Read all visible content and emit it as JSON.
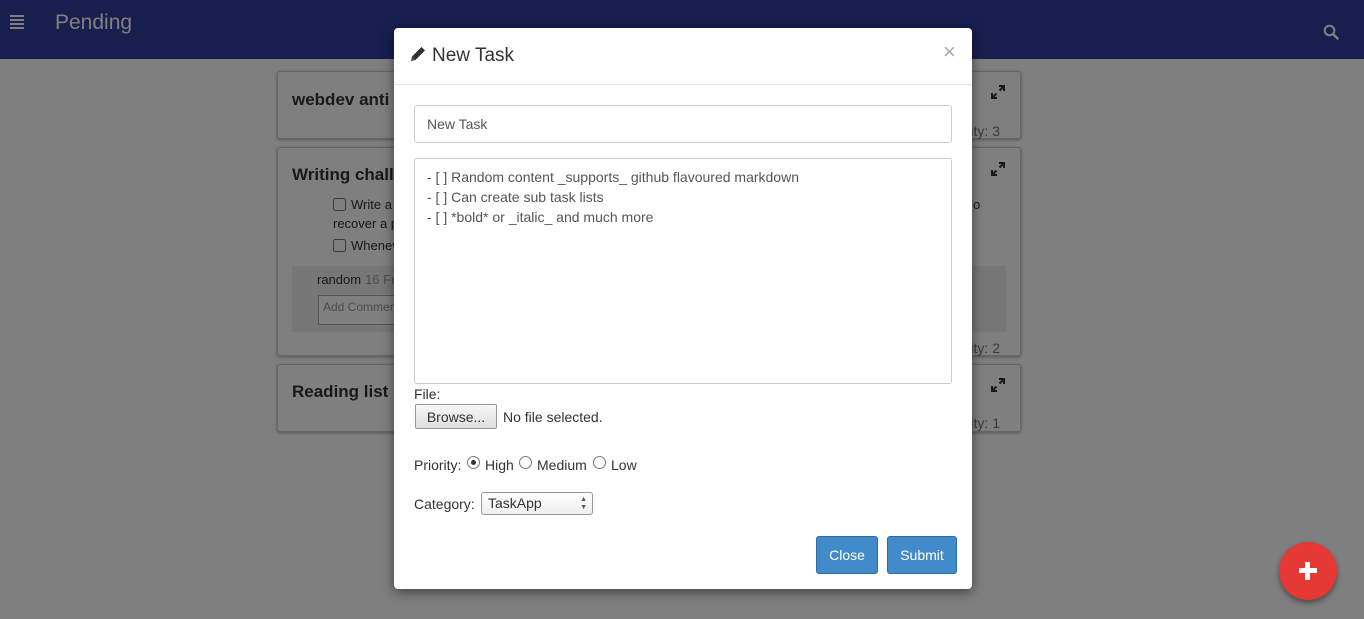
{
  "navbar": {
    "title": "Pending",
    "menu_icon": "hamburger-menu-icon",
    "search_icon": "search-icon",
    "color": "#303f9f"
  },
  "cards": [
    {
      "title": "webdev anti",
      "priority": "ity: 3"
    },
    {
      "title": "Writing chall",
      "priority": "ity: 2",
      "items": [
        {
          "line1": "Write a",
          "line1_tail": "o",
          "line2": "recover a p"
        },
        {
          "line1": "Whenev"
        }
      ],
      "comment": {
        "user": "random",
        "date": "16 Fe",
        "placeholder": "Add Commen"
      }
    },
    {
      "title": "Reading list",
      "priority": "ity: 1"
    }
  ],
  "modal": {
    "title": "New Task",
    "title_icon": "pencil-icon",
    "close_symbol": "×",
    "task_title_value": "New Task",
    "description_value": "- [ ] Random content _supports_ github flavoured markdown\n- [ ] Can create sub task lists\n- [ ] *bold* or _italic_ and much more",
    "file_label": "File:",
    "browse_label": "Browse...",
    "file_status": "No file selected.",
    "priority_label": "Priority:",
    "priority_options": [
      {
        "label": "High",
        "checked": true
      },
      {
        "label": "Medium",
        "checked": false
      },
      {
        "label": "Low",
        "checked": false
      }
    ],
    "category_label": "Category:",
    "category_value": "TaskApp",
    "close_button": "Close",
    "submit_button": "Submit",
    "button_color": "#428bca"
  },
  "fab": {
    "icon": "plus-icon",
    "color": "#e53935"
  }
}
